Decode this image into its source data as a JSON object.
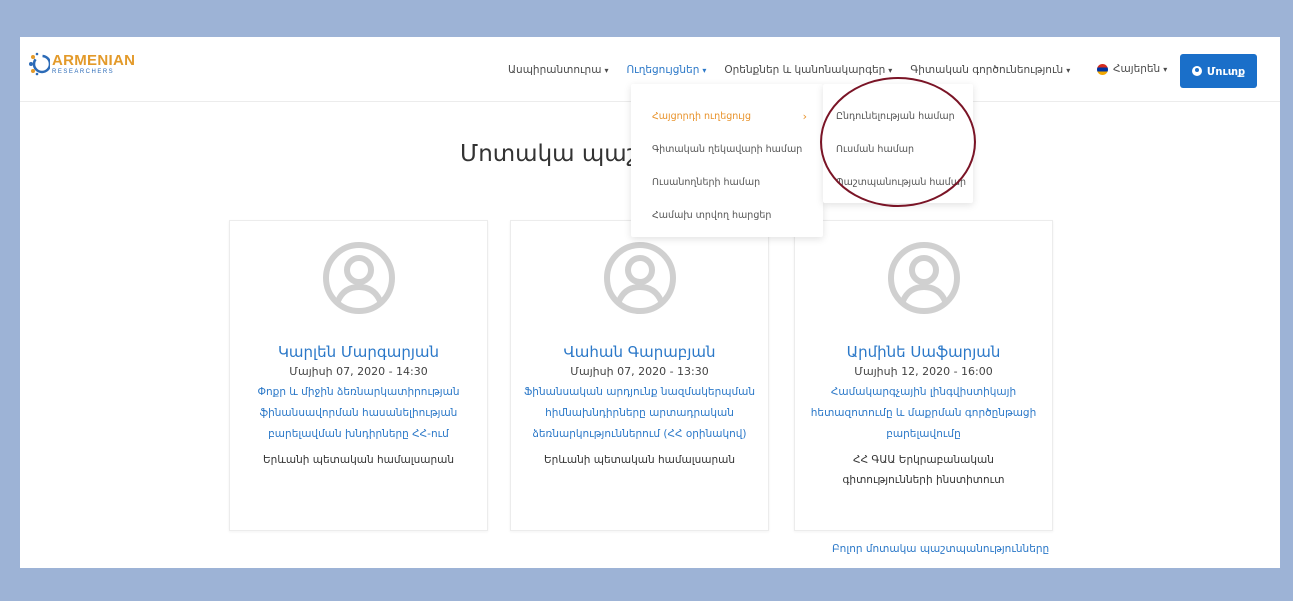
{
  "brand": {
    "title": "ARMENIAN",
    "subtitle": "RESEARCHERS",
    "colors": {
      "title": "#e39a2a",
      "subtitle": "#2c6bb7"
    }
  },
  "nav": {
    "items": [
      {
        "label": "Ասպիրանտուրա",
        "caret": "▾"
      },
      {
        "label": "Ուղեցույցներ",
        "caret": "▾"
      },
      {
        "label": "Օրենքներ և կանոնակարգեր",
        "caret": "▾"
      },
      {
        "label": "Գիտական գործունեություն",
        "caret": "▾"
      }
    ],
    "language": "Հայերեն",
    "language_caret": "▾",
    "login_label": "Մուտք"
  },
  "dropdown": {
    "items": [
      {
        "label": "Հայցորդի ուղեցույց",
        "chevron": "›"
      },
      {
        "label": "Գիտական ղեկավարի համար"
      },
      {
        "label": "Ուսանողների համար"
      },
      {
        "label": "Համախ տրվող հարցեր"
      }
    ]
  },
  "submenu": {
    "items": [
      {
        "label": "Ընդունելության համար"
      },
      {
        "label": "Ուսման համար"
      },
      {
        "label": "Պաշտպանության համար"
      }
    ]
  },
  "main": {
    "heading": "Մոտակա պաշտ",
    "all_link": "Բոլոր մոտակա պաշտպանությունները"
  },
  "defenses": [
    {
      "name": "Կարլեն Մարգարյան",
      "date": "Մայիսի 07, 2020 - 14:30",
      "topic": "Փոքր և միջին ձեռնարկատիրության ֆինանսավորման հասանելիության բարելավման խնդիրները ՀՀ-ում",
      "org": "Երևանի պետական համալսարան"
    },
    {
      "name": "Վահան Գարաբյան",
      "date": "Մայիսի 07, 2020 - 13:30",
      "topic": "Ֆինանսական արդյունք նազմակերպման հիմնախնդիրները արտադրական ձեռնարկություններում (ՀՀ օրինակով)",
      "org": "Երևանի պետական համալսարան"
    },
    {
      "name": "Արմինե Սաֆարյան",
      "date": "Մայիսի 12, 2020 - 16:00",
      "topic": "Համակարգչային լինգվիստիկայի հետազոտումը և մաքրման գործընթացի բարելավումը",
      "org": "ՀՀ ԳԱԱ Երկրաբանական գիտությունների ինստիտուտ"
    }
  ],
  "colors": {
    "accent": "#2b78c8",
    "active_menu": "#e8922a",
    "login_bg": "#1a6fc9",
    "annotation": "#7a1426",
    "page_bg": "#9db3d6"
  }
}
